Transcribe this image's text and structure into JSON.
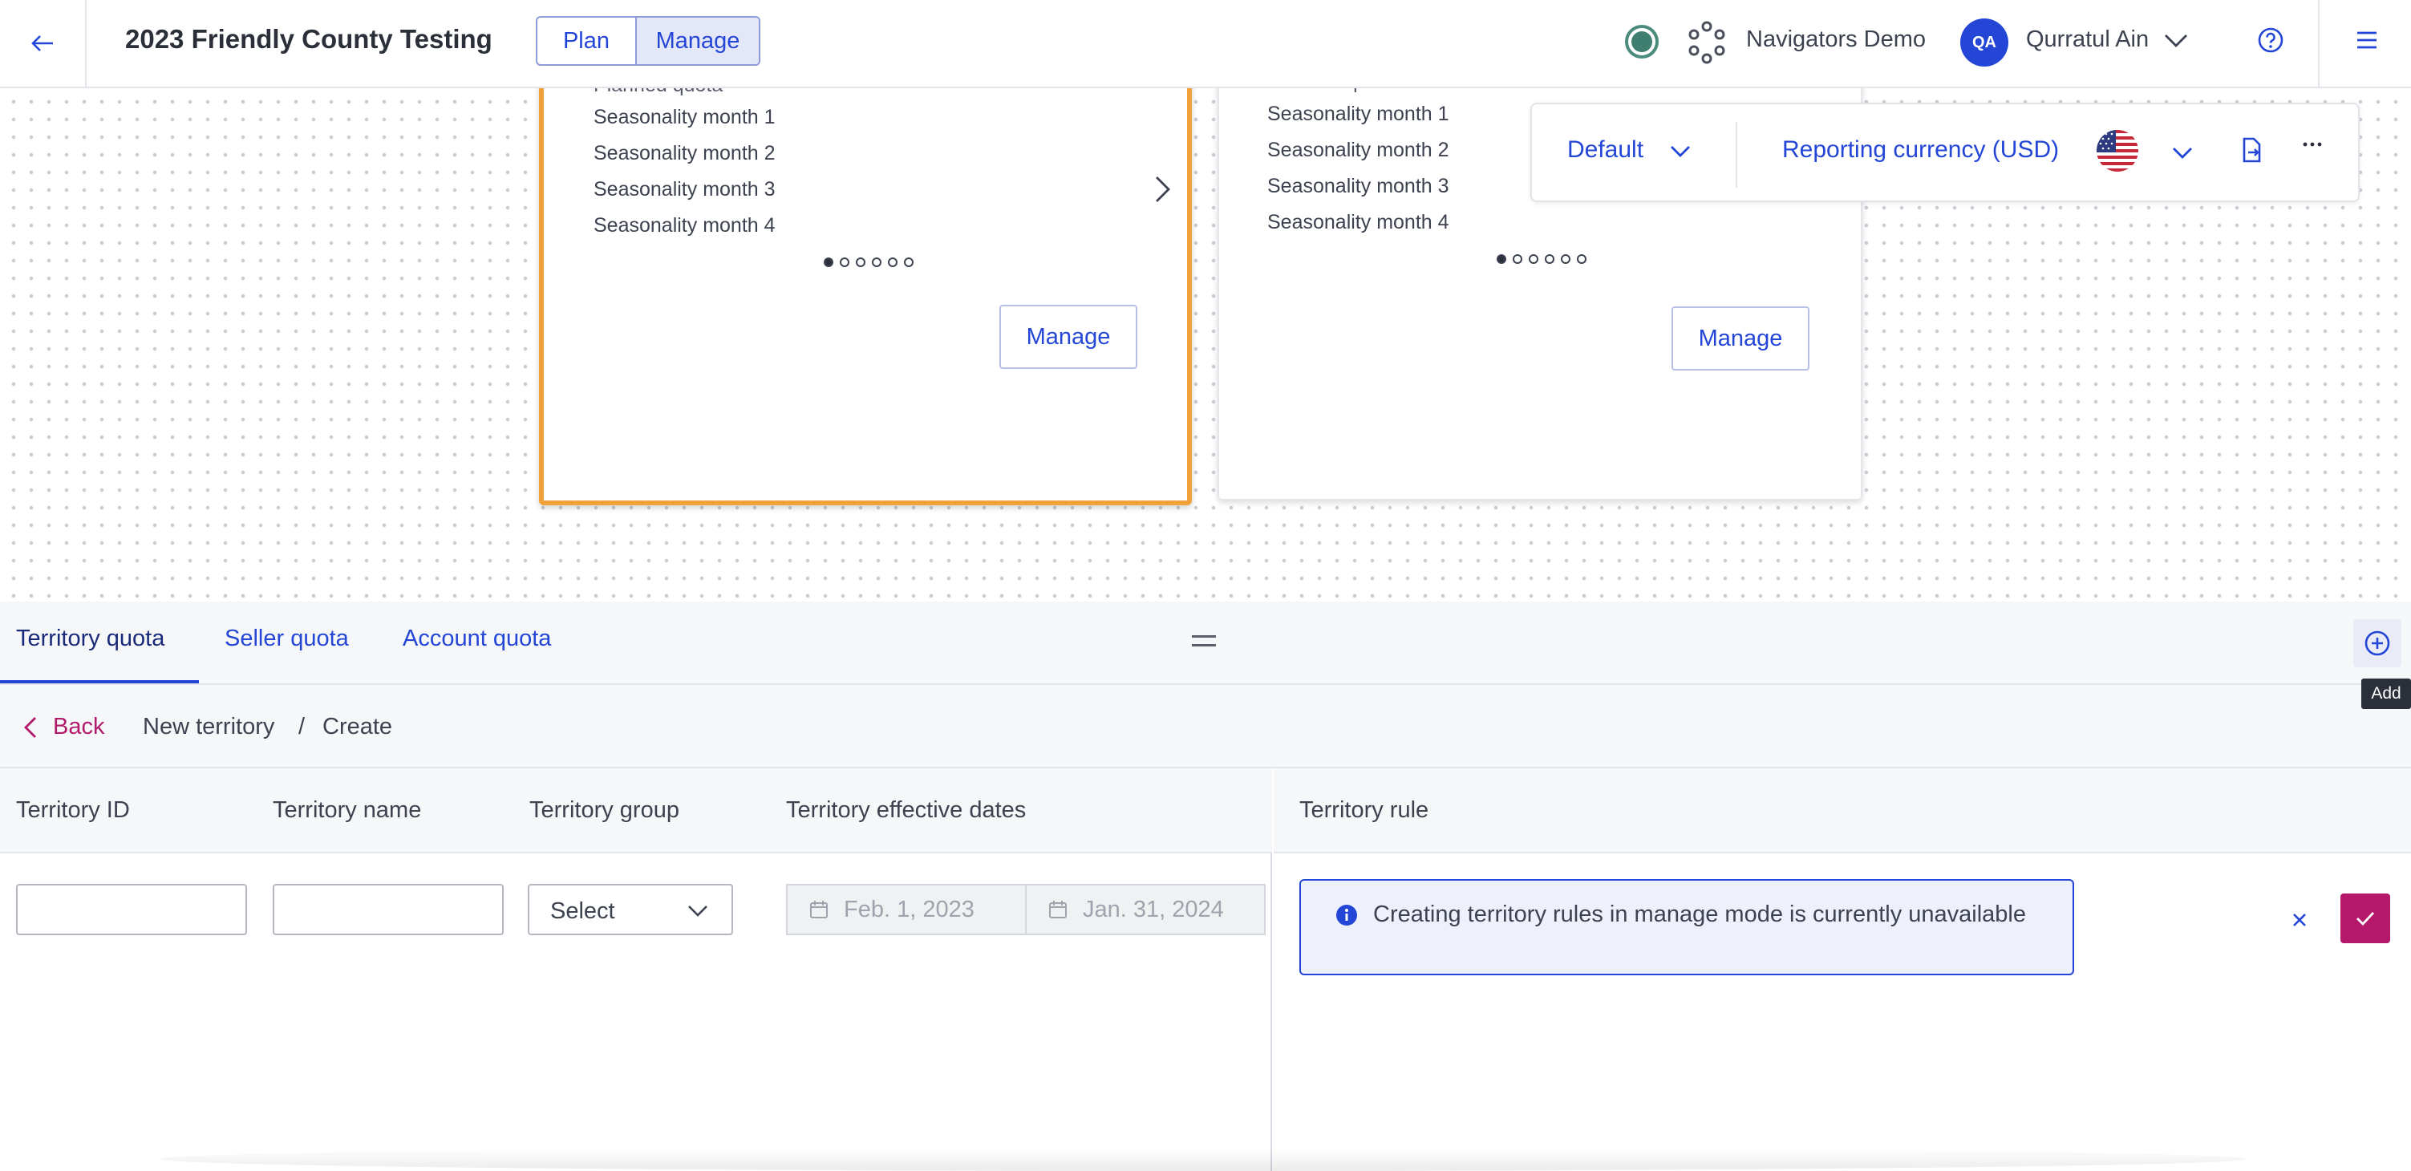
{
  "header": {
    "title": "2023 Friendly County Testing",
    "mode_tabs": [
      "Plan",
      "Manage"
    ],
    "tenant_name": "Navigators Demo",
    "user_initials": "QA",
    "user_name": "Qurratul Ain",
    "icons": [
      "back-arrow-icon",
      "status-icon",
      "tenant-icon",
      "chevron-down-icon",
      "help-icon",
      "menu-icon"
    ]
  },
  "canvas": {
    "cards": [
      {
        "partial_row": "Planned quota",
        "rows": [
          "Seasonality month 1",
          "Seasonality month 2",
          "Seasonality month 3",
          "Seasonality month 4"
        ],
        "pager_total": 6,
        "pager_active": 1,
        "manage_label": "Manage",
        "selected": true
      },
      {
        "partial_row": "Planned quota",
        "rows": [
          "Seasonality month 1",
          "Seasonality month 2",
          "Seasonality month 3",
          "Seasonality month 4"
        ],
        "pager_total": 6,
        "pager_active": 1,
        "manage_label": "Manage",
        "selected": false
      }
    ],
    "toolbar": {
      "view_label": "Default",
      "currency_label": "Reporting currency (USD)",
      "flag": "us-flag-icon"
    }
  },
  "panel": {
    "tabs": [
      "Territory quota",
      "Seller quota",
      "Account quota"
    ],
    "active_tab": "Territory quota",
    "add_tooltip": "Add",
    "breadcrumb": {
      "back_label": "Back",
      "items": [
        "New territory",
        "Create"
      ],
      "separator": "/"
    },
    "columns": [
      "Territory ID",
      "Territory name",
      "Territory group",
      "Territory effective dates"
    ],
    "form": {
      "territory_id": "",
      "territory_name": "",
      "group_select": "Select",
      "start_date": "Feb. 1, 2023",
      "end_date": "Jan. 31, 2024"
    },
    "rule": {
      "header": "Territory rule",
      "notice": "Creating territory rules in manage mode is currently unavailable"
    }
  },
  "colors": {
    "accent": "#2346d6",
    "selected_card": "#f0a23a",
    "confirm": "#b5176a",
    "back_link": "#b21a6b"
  }
}
